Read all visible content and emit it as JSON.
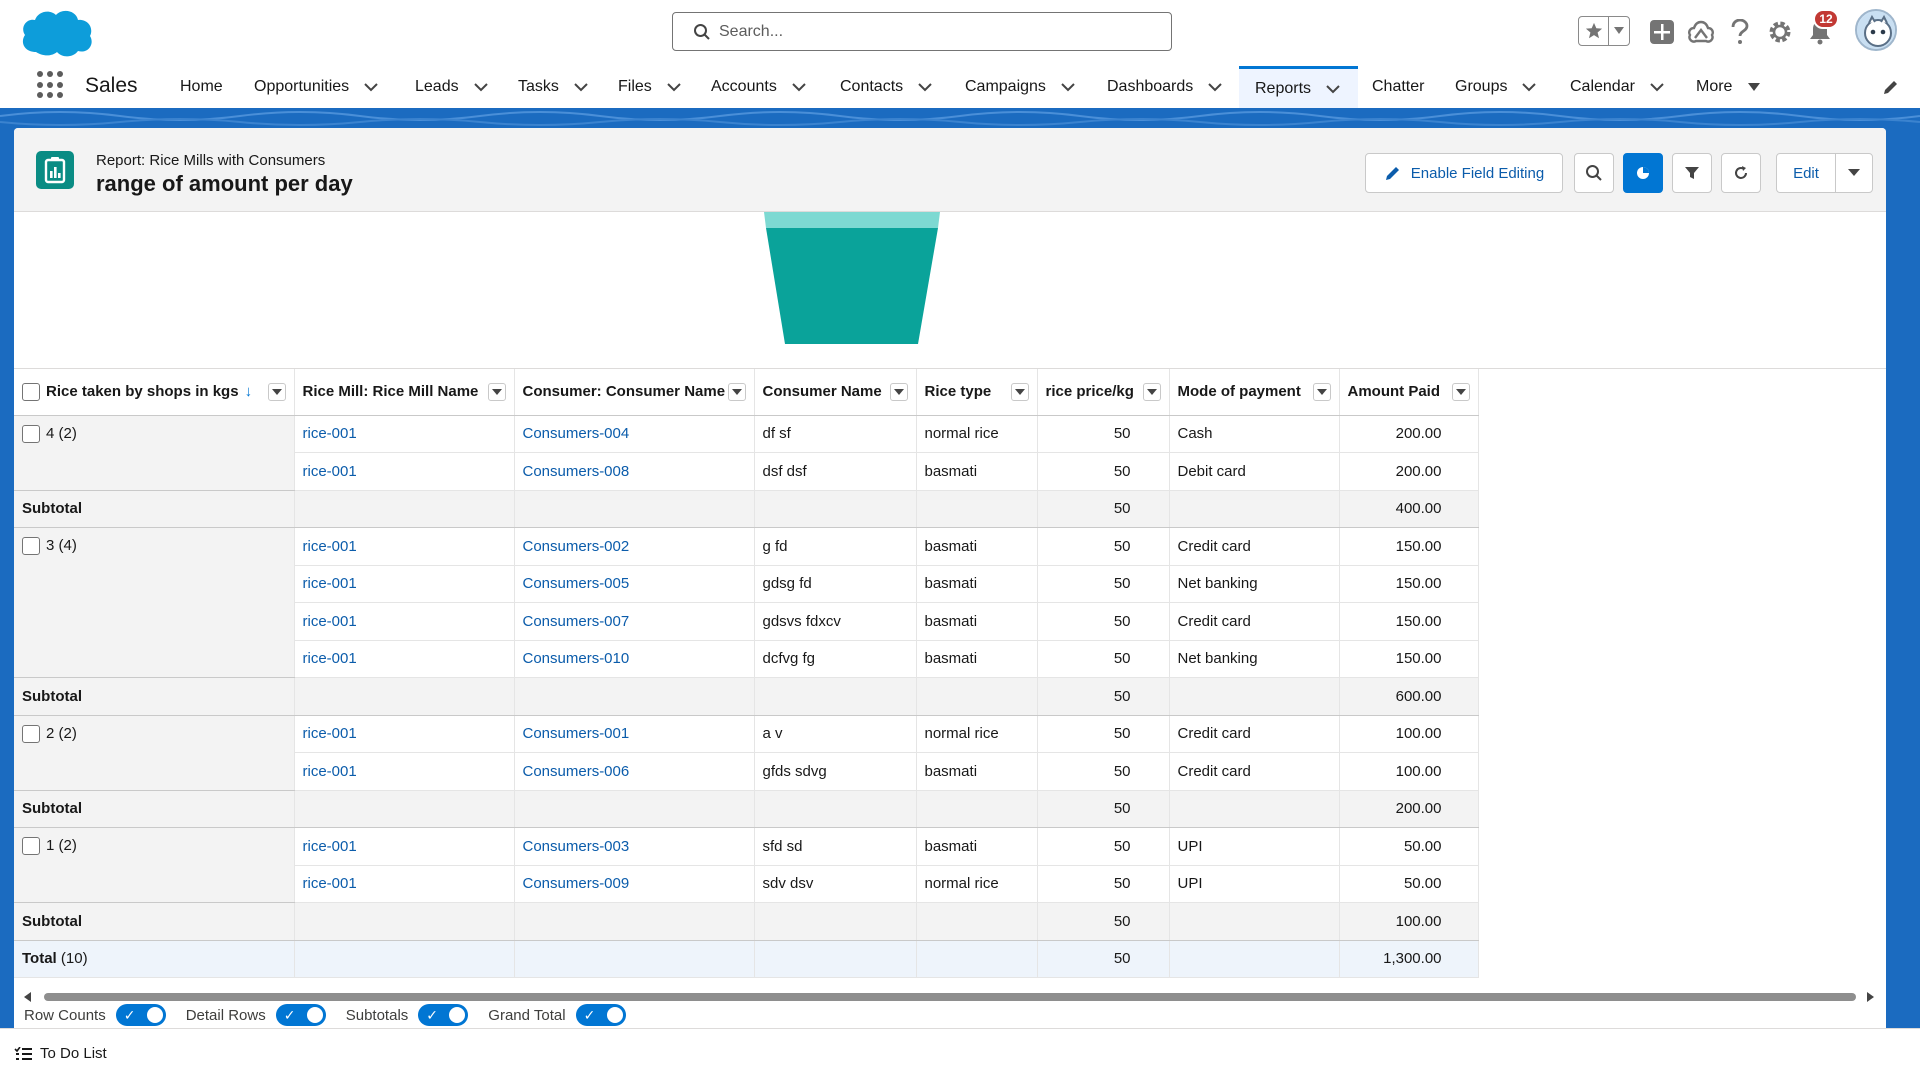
{
  "header": {
    "search_placeholder": "Search...",
    "notifications_count": "12"
  },
  "nav": {
    "app_name": "Sales",
    "items": [
      {
        "label": "Home"
      },
      {
        "label": "Opportunities"
      },
      {
        "label": "Leads"
      },
      {
        "label": "Tasks"
      },
      {
        "label": "Files"
      },
      {
        "label": "Accounts"
      },
      {
        "label": "Contacts"
      },
      {
        "label": "Campaigns"
      },
      {
        "label": "Dashboards"
      },
      {
        "label": "Reports"
      },
      {
        "label": "Chatter"
      },
      {
        "label": "Groups"
      },
      {
        "label": "Calendar"
      },
      {
        "label": "More"
      }
    ],
    "active": "Reports"
  },
  "report": {
    "subtitle": "Report: Rice Mills with Consumers",
    "title": "range of amount per day",
    "enable_field_editing": "Enable Field Editing",
    "edit": "Edit"
  },
  "table": {
    "columns": [
      "Rice taken by shops in kgs",
      "Rice Mill: Rice Mill Name",
      "Consumer: Consumer Name",
      "Consumer Name",
      "Rice type",
      "rice price/kg",
      "Mode of payment",
      "Amount Paid"
    ],
    "groups": [
      {
        "group": "4",
        "count": "(2)",
        "rows": [
          {
            "mill": "rice-001",
            "consumer": "Consumers-004",
            "name": "df sf",
            "type": "normal rice",
            "price": "50",
            "mode": "Cash",
            "amount": "200.00"
          },
          {
            "mill": "rice-001",
            "consumer": "Consumers-008",
            "name": "dsf dsf",
            "type": "basmati",
            "price": "50",
            "mode": "Debit card",
            "amount": "200.00"
          }
        ],
        "subtotal": {
          "label": "Subtotal",
          "price": "50",
          "amount": "400.00"
        }
      },
      {
        "group": "3",
        "count": "(4)",
        "rows": [
          {
            "mill": "rice-001",
            "consumer": "Consumers-002",
            "name": "g fd",
            "type": "basmati",
            "price": "50",
            "mode": "Credit card",
            "amount": "150.00"
          },
          {
            "mill": "rice-001",
            "consumer": "Consumers-005",
            "name": "gdsg fd",
            "type": "basmati",
            "price": "50",
            "mode": "Net banking",
            "amount": "150.00"
          },
          {
            "mill": "rice-001",
            "consumer": "Consumers-007",
            "name": "gdsvs fdxcv",
            "type": "basmati",
            "price": "50",
            "mode": "Credit card",
            "amount": "150.00"
          },
          {
            "mill": "rice-001",
            "consumer": "Consumers-010",
            "name": "dcfvg fg",
            "type": "basmati",
            "price": "50",
            "mode": "Net banking",
            "amount": "150.00"
          }
        ],
        "subtotal": {
          "label": "Subtotal",
          "price": "50",
          "amount": "600.00"
        }
      },
      {
        "group": "2",
        "count": "(2)",
        "rows": [
          {
            "mill": "rice-001",
            "consumer": "Consumers-001",
            "name": "a v",
            "type": "normal rice",
            "price": "50",
            "mode": "Credit card",
            "amount": "100.00"
          },
          {
            "mill": "rice-001",
            "consumer": "Consumers-006",
            "name": "gfds sdvg",
            "type": "basmati",
            "price": "50",
            "mode": "Credit card",
            "amount": "100.00"
          }
        ],
        "subtotal": {
          "label": "Subtotal",
          "price": "50",
          "amount": "200.00"
        }
      },
      {
        "group": "1",
        "count": "(2)",
        "rows": [
          {
            "mill": "rice-001",
            "consumer": "Consumers-003",
            "name": "sfd sd",
            "type": "basmati",
            "price": "50",
            "mode": "UPI",
            "amount": "50.00"
          },
          {
            "mill": "rice-001",
            "consumer": "Consumers-009",
            "name": "sdv dsv",
            "type": "normal rice",
            "price": "50",
            "mode": "UPI",
            "amount": "50.00"
          }
        ],
        "subtotal": {
          "label": "Subtotal",
          "price": "50",
          "amount": "100.00"
        }
      }
    ],
    "total": {
      "label": "Total",
      "count": "(10)",
      "price": "50",
      "amount": "1,300.00"
    }
  },
  "toggles": [
    {
      "label": "Row Counts",
      "on": true
    },
    {
      "label": "Detail Rows",
      "on": true
    },
    {
      "label": "Subtotals",
      "on": true
    },
    {
      "label": "Grand Total",
      "on": true
    }
  ],
  "utility": {
    "todo_label": "To Do List"
  },
  "colors": {
    "brand": "#0176d3",
    "funnel_top": "#7dd9d2",
    "funnel_body": "#0aa39a",
    "notification": "#c23934"
  }
}
